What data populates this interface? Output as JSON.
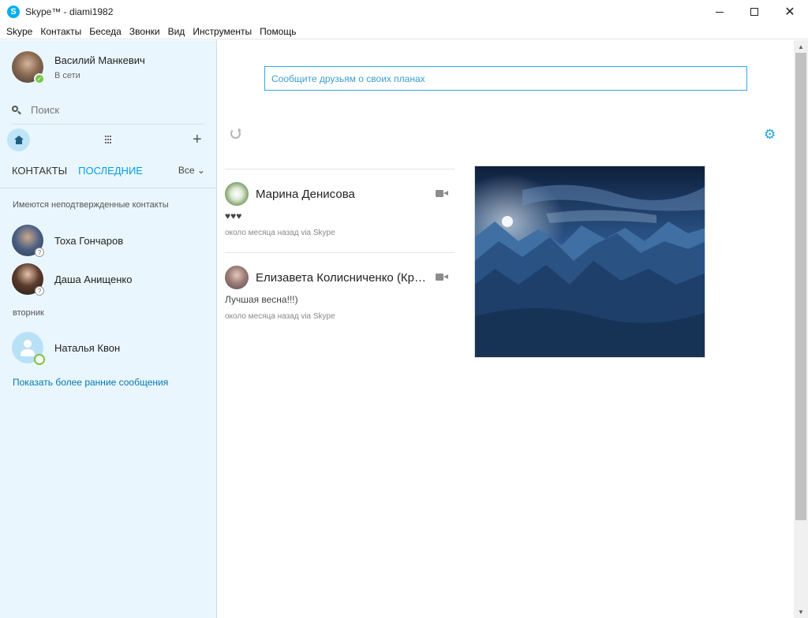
{
  "window": {
    "logo_letter": "S",
    "title": "Skype™ - diami1982",
    "close_glyph": "✕"
  },
  "menu": [
    "Skype",
    "Контакты",
    "Беседа",
    "Звонки",
    "Вид",
    "Инструменты",
    "Помощь"
  ],
  "profile": {
    "name": "Василий Манкевич",
    "status": "В сети",
    "status_mark": "✓"
  },
  "search": {
    "placeholder": "Поиск"
  },
  "toolbar": {
    "add_glyph": "+"
  },
  "tabs": {
    "contacts": "КОНТАКТЫ",
    "recent": "ПОСЛЕДНИЕ",
    "filter": "Все ⌄"
  },
  "sidebar": {
    "unconfirmed_label": "Имеются неподтвержденные контакты",
    "day_label": "вторник",
    "unknown_mark": "?",
    "contacts": [
      {
        "name": "Тоха Гончаров"
      },
      {
        "name": "Даша Анищенко"
      },
      {
        "name": "Наталья Квон"
      }
    ],
    "show_more": "Показать более ранние сообщения"
  },
  "main": {
    "mood_placeholder": "Сообщите друзьям о своих планах",
    "gear_glyph": "⚙"
  },
  "feed": [
    {
      "name": "Марина Денисова",
      "message": "♥♥♥",
      "time": "около месяца назад via Skype"
    },
    {
      "name": "Елизавета Колисниченко (Кравченко)",
      "message": "Лучшая весна!!!)",
      "time": "около месяца назад via Skype"
    }
  ],
  "scrollbar": {
    "up": "▲",
    "down": "▼"
  },
  "colors": {
    "accent": "#00aff0",
    "sidebar_bg": "#eaf6fd",
    "link": "#0078b5",
    "online": "#7bc443"
  }
}
